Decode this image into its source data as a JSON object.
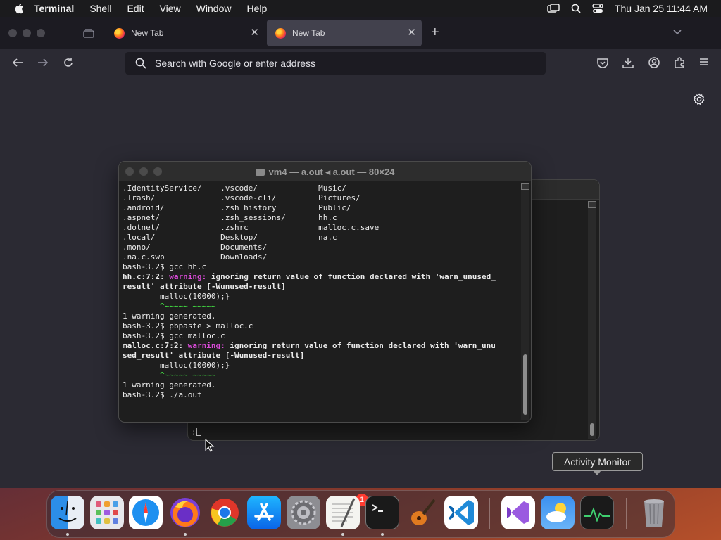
{
  "menubar": {
    "app": "Terminal",
    "items": [
      "Shell",
      "Edit",
      "View",
      "Window",
      "Help"
    ],
    "clock": "Thu Jan 25  11:44 AM"
  },
  "browser": {
    "tabs": [
      {
        "label": "New Tab",
        "icon": "firefox-icon"
      },
      {
        "label": "New Tab",
        "icon": "firefox-icon",
        "active": true
      }
    ],
    "address_placeholder": "Search with Google or enter address"
  },
  "terminal": {
    "title": "vm4 — a.out ◂ a.out — 80×24",
    "lines": [
      ".IdentityService/    .vscode/             Music/",
      ".Trash/              .vscode-cli/         Pictures/",
      ".android/            .zsh_history         Public/",
      ".aspnet/             .zsh_sessions/       hh.c",
      ".dotnet/             .zshrc               malloc.c.save",
      ".local/              Desktop/             na.c",
      ".mono/               Documents/",
      ".na.c.swp            Downloads/"
    ],
    "cmd1": "bash-3.2$ gcc hh.c",
    "warn1_loc": "hh.c:7:2: ",
    "warn_word": "warning:",
    "warn1_msg": " ignoring return value of function declared with 'warn_unused_",
    "warn1_cont": "result' attribute [-Wunused-result]",
    "code": "        malloc(10000);}",
    "caret": "        ^~~~~~ ~~~~~",
    "generated": "1 warning generated.",
    "cmd2": "bash-3.2$ pbpaste > malloc.c",
    "cmd3": "bash-3.2$ gcc malloc.c",
    "warn2_loc": "malloc.c:7:2: ",
    "warn2_msg": " ignoring return value of function declared with 'warn_unu",
    "warn2_cont": "sed_result' attribute [-Wunused-result]",
    "cmd4": "bash-3.2$ ./a.out",
    "back_prompt": ":"
  },
  "tooltip": "Activity Monitor",
  "dock": {
    "badge": "1",
    "apps": [
      "Finder",
      "Launchpad",
      "Safari",
      "Firefox",
      "Google Chrome",
      "App Store",
      "System Settings",
      "TextEdit",
      "Terminal",
      "GarageBand",
      "Visual Studio Code",
      "Visual Studio",
      "Weather",
      "Activity Monitor",
      "Trash"
    ]
  },
  "colors": {
    "warning": "#d94ad8",
    "caret": "#3fcf3f",
    "browser_bg": "#2b2a33",
    "terminal_bg": "#1e1e1e"
  }
}
